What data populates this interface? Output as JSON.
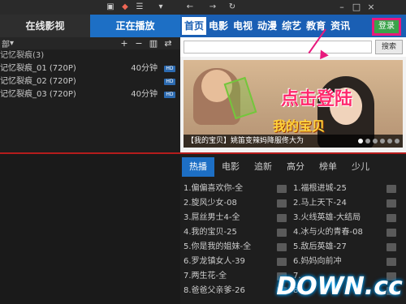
{
  "top_icons": [
    "chat-icon",
    "palette-icon",
    "list-icon",
    "back-arrow-icon",
    "forward-arrow-icon",
    "refresh-icon"
  ],
  "window_buttons": [
    "–",
    "□",
    "×"
  ],
  "left": {
    "tabs": [
      {
        "label": "在线影视",
        "active": false
      },
      {
        "label": "正在播放",
        "active": true
      }
    ],
    "playlist_bar_label": "部",
    "rows": [
      {
        "title": "记忆裂痕(3)",
        "duration": "",
        "hd": false,
        "group": true
      },
      {
        "title": "记忆裂痕_01 (720P)",
        "duration": "40分钟",
        "hd": true
      },
      {
        "title": "记忆裂痕_02 (720P)",
        "duration": "",
        "hd": true
      },
      {
        "title": "记忆裂痕_03 (720P)",
        "duration": "40分钟",
        "hd": true
      }
    ],
    "hd_label": "HD"
  },
  "nav": {
    "items": [
      "首页",
      "电影",
      "电视",
      "动漫",
      "综艺",
      "教育",
      "资讯"
    ],
    "login_label": "登录"
  },
  "search": {
    "placeholder": "",
    "button_label": "搜索"
  },
  "banner": {
    "click_text": "点击登陆",
    "logo_text": "我的宝贝",
    "caption": "【我的宝贝】姚笛变辣妈降服佟大为"
  },
  "lower": {
    "tabs": [
      "热播",
      "电影",
      "追新",
      "高分",
      "榜单",
      "少儿"
    ],
    "items": [
      "1.偏偏喜欢你-全",
      "1.福根进城-25",
      "2.旋风少女-08",
      "2.马上天下-24",
      "3.屌丝男士4-全",
      "3.火线英雄-大结局",
      "4.我的宝贝-25",
      "4.冰与火的青春-08",
      "5.你是我的姐妹-全",
      "5.敌后英雄-27",
      "6.罗龙镇女人-39",
      "6.妈妈向前冲",
      "7.两生花-全",
      "7.",
      "8.爸爸父亲爹-26",
      "8."
    ]
  },
  "watermark": "DOWN.cc"
}
